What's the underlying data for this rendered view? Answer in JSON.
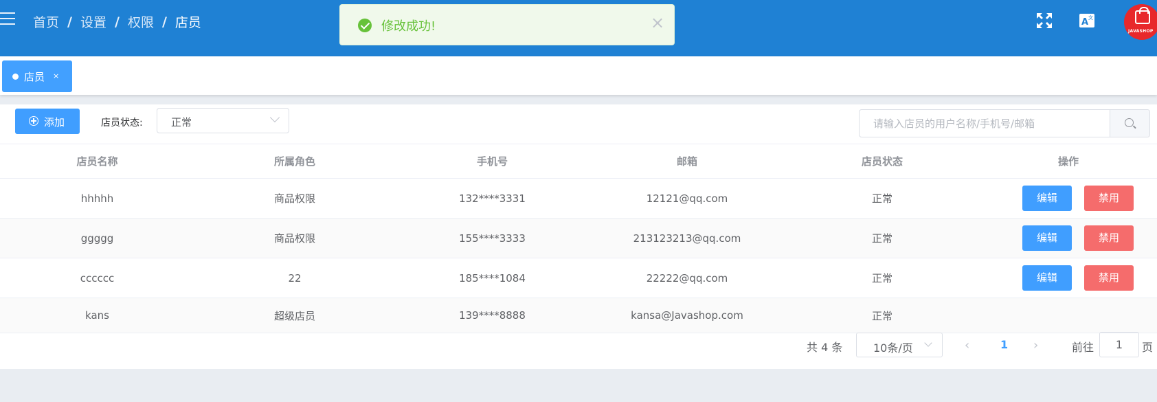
{
  "header": {
    "breadcrumb": [
      "首页",
      "设置",
      "权限",
      "店员"
    ],
    "separator": "/",
    "avatar_brand": "JAVASHOP"
  },
  "toast": {
    "message": "修改成功!",
    "close": "×"
  },
  "tags": [
    {
      "label": "店员",
      "close": "×"
    }
  ],
  "toolbar": {
    "add_label": "添加",
    "status_label": "店员状态:",
    "status_value": "正常",
    "search_placeholder": "请输入店员的用户名称/手机号/邮箱"
  },
  "table": {
    "columns": [
      "店员名称",
      "所属角色",
      "手机号",
      "邮箱",
      "店员状态",
      "操作"
    ],
    "rows": [
      {
        "name": "hhhhh",
        "role": "商品权限",
        "phone": "132****3331",
        "email": "12121@qq.com",
        "status": "正常",
        "actions": true
      },
      {
        "name": "ggggg",
        "role": "商品权限",
        "phone": "155****3333",
        "email": "213123213@qq.com",
        "status": "正常",
        "actions": true
      },
      {
        "name": "cccccc",
        "role": "22",
        "phone": "185****1084",
        "email": "22222@qq.com",
        "status": "正常",
        "actions": true
      },
      {
        "name": "kans",
        "role": "超级店员",
        "phone": "139****8888",
        "email": "kansa@Javashop.com",
        "status": "正常",
        "actions": false
      }
    ],
    "edit_label": "编辑",
    "disable_label": "禁用"
  },
  "pagination": {
    "total": "共 4 条",
    "page_size": "10条/页",
    "prev": "‹",
    "current": "1",
    "next": "›",
    "goto_prefix": "前往",
    "goto_value": "1",
    "goto_suffix": "页"
  }
}
